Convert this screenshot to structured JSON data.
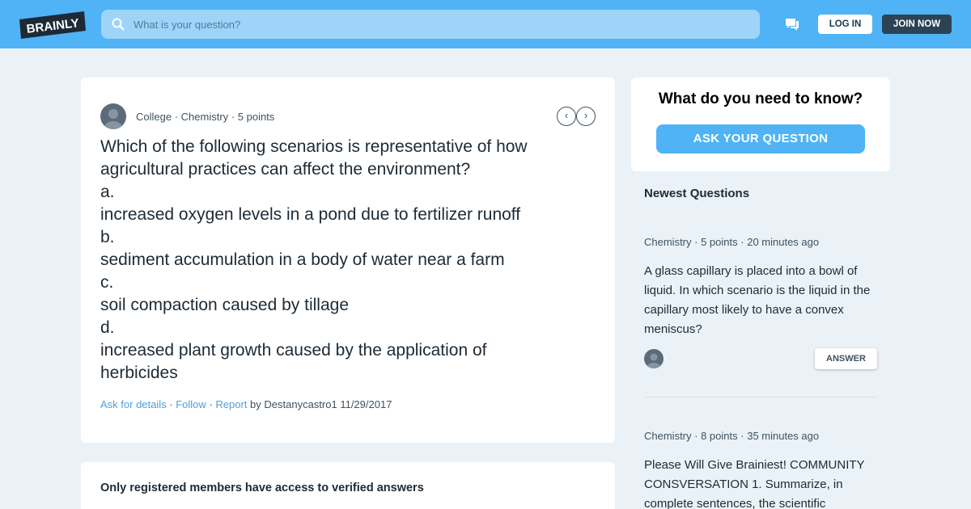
{
  "header": {
    "logo_text": "BRAINLY",
    "search_placeholder": "What is your question?",
    "login_label": "LOG IN",
    "join_label": "JOIN NOW"
  },
  "question": {
    "level": "College",
    "subject": "Chemistry",
    "points": "5 points",
    "lines": [
      "Which of the following scenarios is representative of how",
      "agricultural practices can affect the environment?",
      "a.",
      "increased oxygen levels in a pond due to fertilizer runoff",
      "b.",
      "sediment accumulation in a body of water near a farm",
      "c.",
      "soil compaction caused by tillage",
      "d.",
      "increased plant growth caused by the application of",
      "herbicides"
    ],
    "ask_details": "Ask for details",
    "follow": "Follow",
    "report": "Report",
    "by_text": "by Destanycastro1 11/29/2017"
  },
  "registered_notice": "Only registered members have access to verified answers",
  "ask_card": {
    "heading": "What do you need to know?",
    "button": "ASK YOUR QUESTION"
  },
  "newest": {
    "title": "Newest Questions",
    "items": [
      {
        "subject": "Chemistry",
        "points": "5 points",
        "time": "20 minutes ago",
        "text": "A glass capillary is placed into a bowl of liquid. In which scenario is the liquid in the capillary most likely to have a convex meniscus?",
        "answer_label": "ANSWER"
      },
      {
        "subject": "Chemistry",
        "points": "8 points",
        "time": "35 minutes ago",
        "text": "Please Will Give Brainiest! COMMUNITY CONSVERSATION 1. Summarize, in complete sentences, the scientific"
      }
    ]
  },
  "colors": {
    "brand_blue": "#4fb3f6",
    "dark_navy": "#2b4355",
    "page_bg": "#ebf2f7",
    "link_blue": "#4fa0d6"
  },
  "icons": {
    "search": "search-icon",
    "messages": "chat-bubble-icon",
    "prev": "chevron-left-icon",
    "next": "chevron-right-icon",
    "avatar": "user-avatar-icon"
  }
}
